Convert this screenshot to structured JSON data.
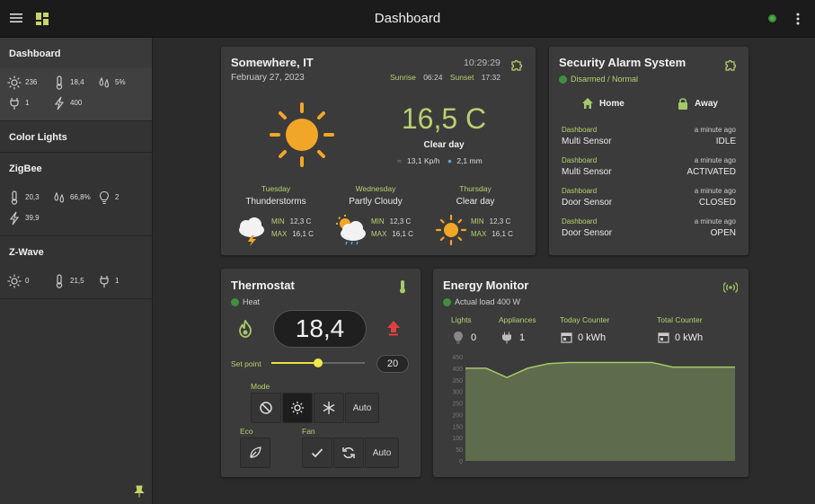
{
  "header": {
    "title": "Dashboard"
  },
  "sidebar": {
    "sections": [
      {
        "title": "Dashboard",
        "sensors": [
          {
            "icon": "sun-icon",
            "value": "236"
          },
          {
            "icon": "thermometer-icon",
            "value": "18,4"
          },
          {
            "icon": "drops-icon",
            "value": "5%"
          },
          {
            "icon": "plug-icon",
            "value": "1"
          },
          {
            "icon": "bolt-icon",
            "value": "400"
          }
        ]
      },
      {
        "title": "Color Lights"
      },
      {
        "title": "ZigBee",
        "sensors": [
          {
            "icon": "thermometer-icon",
            "value": "20,3"
          },
          {
            "icon": "drops-icon",
            "value": "66,8%"
          },
          {
            "icon": "bulb-icon",
            "value": "2"
          },
          {
            "icon": "bolt-icon",
            "value": "39,9"
          }
        ]
      },
      {
        "title": "Z-Wave",
        "sensors": [
          {
            "icon": "sun-icon",
            "value": "0"
          },
          {
            "icon": "thermometer-icon",
            "value": "21,5"
          },
          {
            "icon": "plug-icon",
            "value": "1"
          }
        ]
      }
    ]
  },
  "weather": {
    "location": "Somewhere, IT",
    "date": "February 27, 2023",
    "time": "10:29:29",
    "sunrise_label": "Sunrise",
    "sunrise": "06:24",
    "sunset_label": "Sunset",
    "sunset": "17:32",
    "temperature": "16,5 C",
    "condition": "Clear day",
    "wind": "13,1 Kp/h",
    "rain": "2,1 mm",
    "min_label": "MIN",
    "max_label": "MAX",
    "forecast": [
      {
        "day": "Tuesday",
        "cond": "Thunderstorms",
        "min": "12,3 C",
        "max": "16,1 C",
        "icon": "thunderstorm-icon"
      },
      {
        "day": "Wednesday",
        "cond": "Partly Cloudy",
        "min": "12,3 C",
        "max": "16,1 C",
        "icon": "partly-cloudy-icon"
      },
      {
        "day": "Thursday",
        "cond": "Clear day",
        "min": "12,3 C",
        "max": "16,1 C",
        "icon": "sun-icon"
      }
    ]
  },
  "alarm": {
    "title": "Security Alarm System",
    "status": "Disarmed / Normal",
    "home_label": "Home",
    "away_label": "Away",
    "events": [
      {
        "source": "Dashboard",
        "time": "a minute ago",
        "name": "Multi Sensor",
        "state": "IDLE"
      },
      {
        "source": "Dashboard",
        "time": "a minute ago",
        "name": "Multi Sensor",
        "state": "ACTIVATED"
      },
      {
        "source": "Dashboard",
        "time": "a minute ago",
        "name": "Door Sensor",
        "state": "CLOSED"
      },
      {
        "source": "Dashboard",
        "time": "a minute ago",
        "name": "Door Sensor",
        "state": "OPEN"
      }
    ]
  },
  "thermostat": {
    "title": "Thermostat",
    "status": "Heat",
    "temperature": "18,4",
    "setpoint_label": "Set point",
    "setpoint": "20",
    "setpoint_level": 0.5,
    "mode_label": "Mode",
    "mode_auto": "Auto",
    "eco_label": "Eco",
    "fan_label": "Fan",
    "fan_auto": "Auto"
  },
  "energy": {
    "title": "Energy Monitor",
    "status": "Actual load 400 W",
    "lights_label": "Lights",
    "lights": "0",
    "appliances_label": "Appliances",
    "appliances": "1",
    "today_label": "Today Counter",
    "today": "0 kWh",
    "total_label": "Total Counter",
    "total": "0 kWh"
  },
  "colors": {
    "accent": "#b7d071",
    "sun": "#f2a628",
    "status_green": "#3f8f3f",
    "heat_red": "#e04040",
    "chart_fill": "#5f6b4d"
  },
  "chart_data": {
    "type": "area",
    "y_ticks": [
      "450",
      "400",
      "350",
      "300",
      "250",
      "200",
      "150",
      "100",
      "50",
      "0"
    ],
    "ylim": [
      0,
      450
    ],
    "values": [
      400,
      400,
      360,
      400,
      420,
      425,
      425,
      425,
      425,
      425,
      405,
      405,
      405,
      405
    ],
    "grid": false
  }
}
